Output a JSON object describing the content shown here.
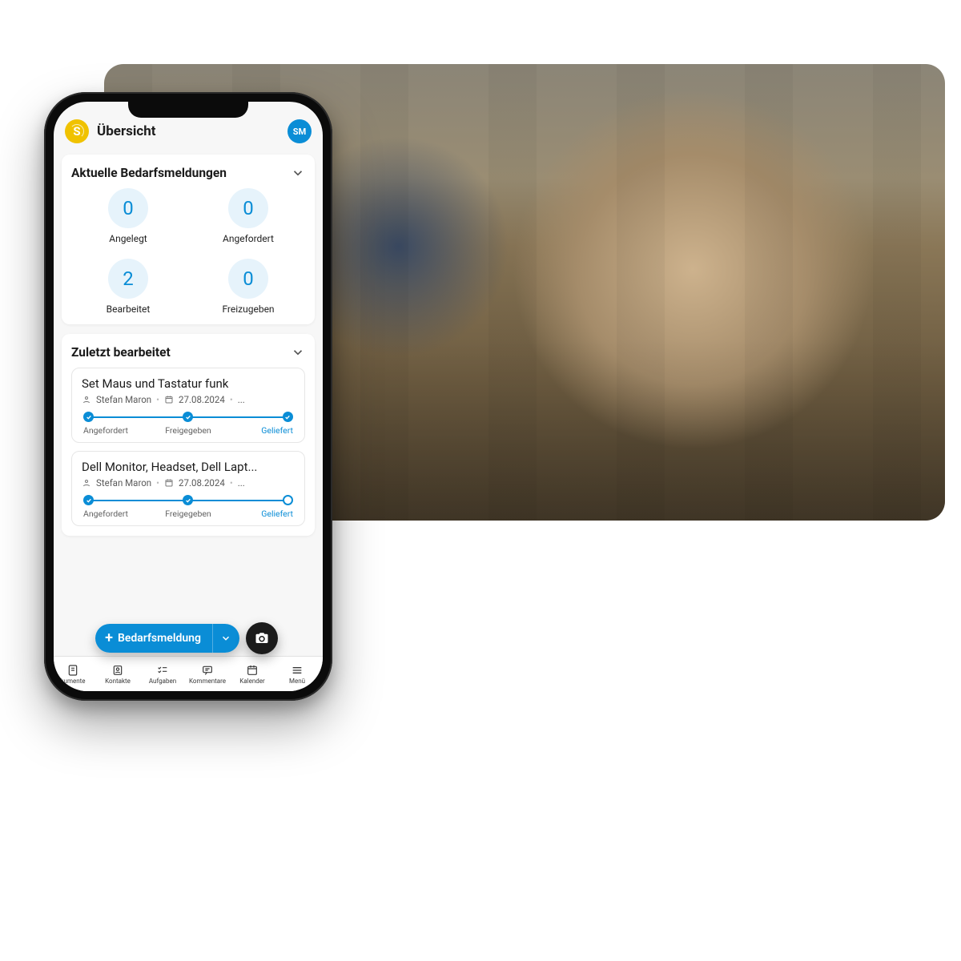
{
  "header": {
    "title": "Übersicht",
    "avatar_initials": "SM",
    "logo_letter": "S"
  },
  "stats_card": {
    "title": "Aktuelle Bedarfsmeldungen",
    "items": [
      {
        "value": "0",
        "label": "Angelegt"
      },
      {
        "value": "0",
        "label": "Angefordert"
      },
      {
        "value": "2",
        "label": "Bearbeitet"
      },
      {
        "value": "0",
        "label": "Freizugeben"
      }
    ]
  },
  "recent_card": {
    "title": "Zuletzt bearbeitet",
    "items": [
      {
        "title": "Set Maus und Tastatur funk",
        "author": "Stefan Maron",
        "date": "27.08.2024",
        "steps": [
          "Angefordert",
          "Freigegeben",
          "Geliefert"
        ],
        "active_index": 2,
        "last_hollow": false
      },
      {
        "title": "Dell Monitor, Headset, Dell Lapt...",
        "author": "Stefan Maron",
        "date": "27.08.2024",
        "steps": [
          "Angefordert",
          "Freigegeben",
          "Geliefert"
        ],
        "active_index": 2,
        "last_hollow": true
      }
    ]
  },
  "fab": {
    "label": "Bedarfsmeldung"
  },
  "nav": {
    "items": [
      {
        "label": "kumente"
      },
      {
        "label": "Kontakte"
      },
      {
        "label": "Aufgaben"
      },
      {
        "label": "Kommentare"
      },
      {
        "label": "Kalender"
      },
      {
        "label": "Menü"
      }
    ]
  },
  "colors": {
    "accent": "#0a8dd6",
    "bubble_bg": "#e6f3fb",
    "logo": "#f0c200"
  }
}
